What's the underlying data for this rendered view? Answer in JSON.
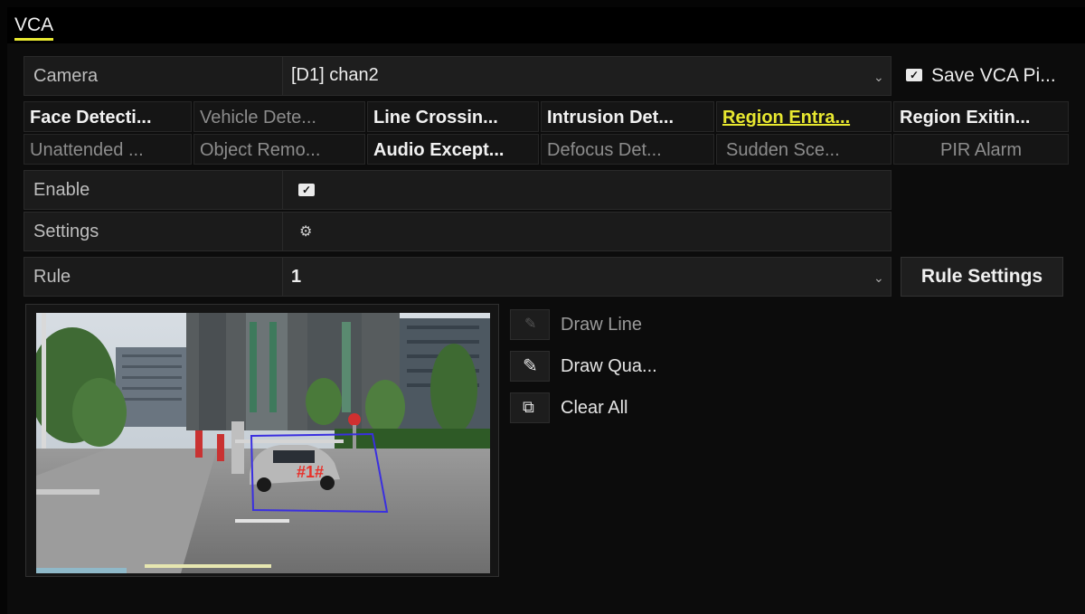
{
  "title": "VCA",
  "camera": {
    "label": "Camera",
    "value": "[D1] chan2",
    "save_label": "Save VCA Pi..."
  },
  "tabs_row1": [
    "Face Detecti...",
    "Vehicle Dete...",
    "Line Crossin...",
    "Intrusion Det...",
    "Region Entra...",
    "Region Exitin..."
  ],
  "tabs_row2": [
    "Unattended ...",
    "Object Remo...",
    "Audio Except...",
    "Defocus Det...",
    "Sudden Sce...",
    "PIR Alarm"
  ],
  "enable": {
    "label": "Enable",
    "checked": true
  },
  "settings": {
    "label": "Settings",
    "icon": "gear-icon"
  },
  "rule": {
    "label": "Rule",
    "value": "1",
    "button": "Rule Settings"
  },
  "preview": {
    "region_label": "#1#"
  },
  "tools": {
    "draw_line": "Draw Line",
    "draw_quad": "Draw Qua...",
    "clear_all": "Clear All"
  },
  "colors": {
    "accent": "#e8e830",
    "region_box": "#3a2fe0",
    "region_label": "#e8302a"
  }
}
